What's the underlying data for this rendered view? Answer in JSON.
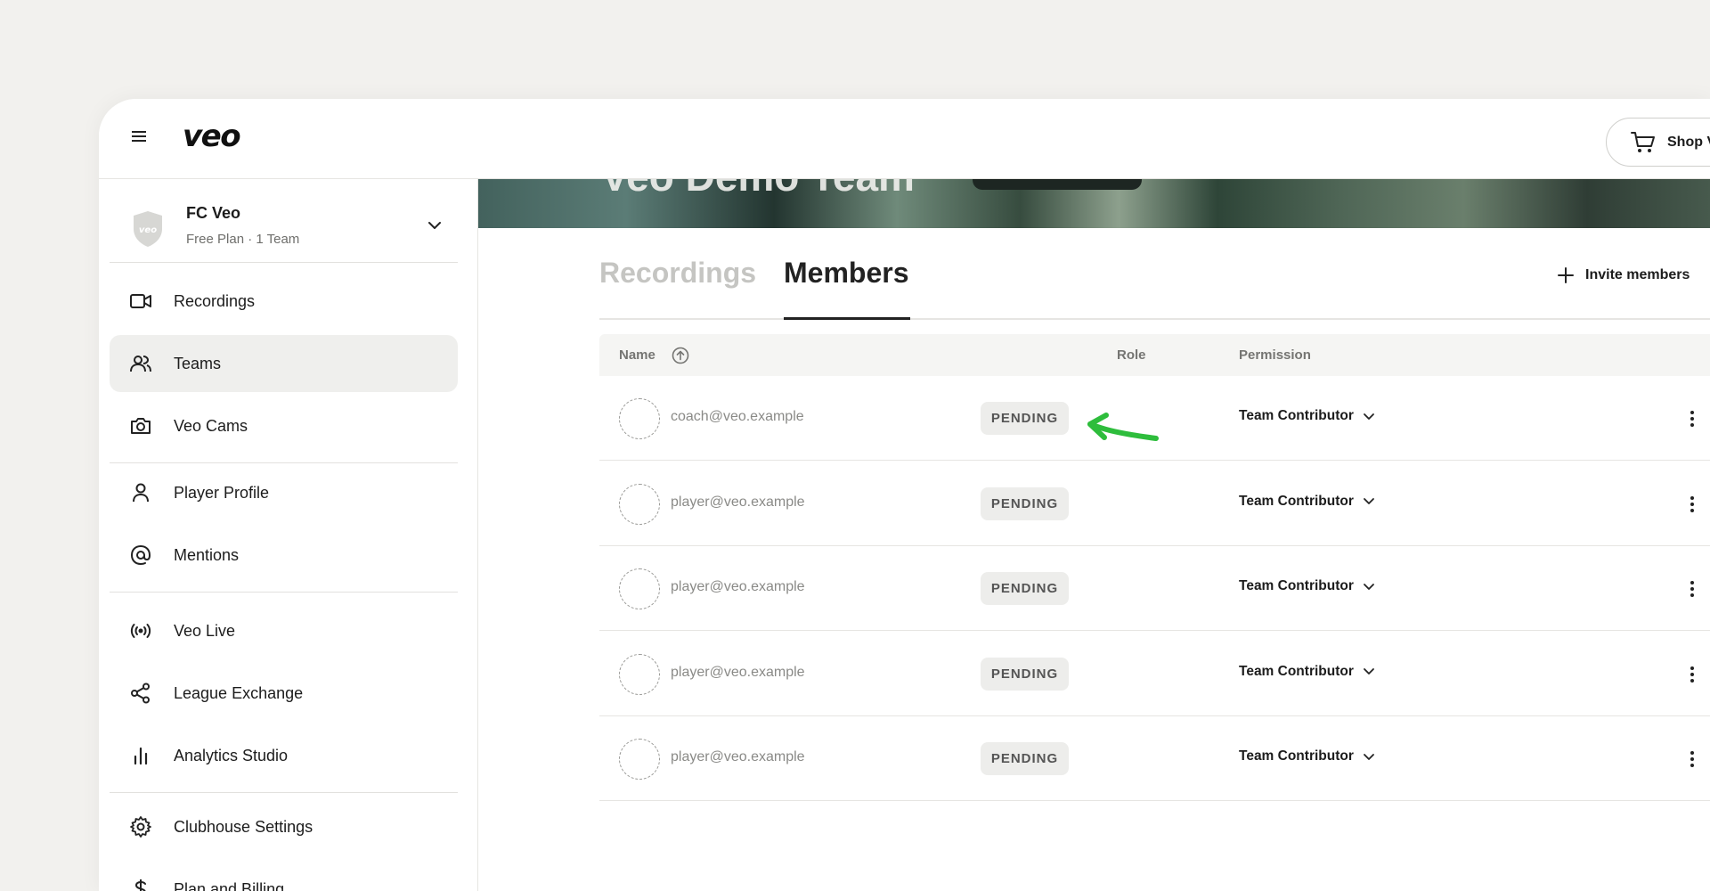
{
  "app": {
    "logo": "veo"
  },
  "header": {
    "shop_label": "Shop V"
  },
  "club": {
    "name": "FC Veo",
    "plan": "Free Plan · 1 Team",
    "shield_text": "veo"
  },
  "sidebar": {
    "items": [
      {
        "label": "Recordings",
        "icon": "video-icon"
      },
      {
        "label": "Teams",
        "icon": "users-icon",
        "active": true
      },
      {
        "label": "Veo Cams",
        "icon": "camera-icon"
      },
      {
        "label": "Player Profile",
        "icon": "person-icon"
      },
      {
        "label": "Mentions",
        "icon": "at-icon"
      },
      {
        "label": "Veo Live",
        "icon": "broadcast-icon"
      },
      {
        "label": "League Exchange",
        "icon": "share-icon"
      },
      {
        "label": "Analytics Studio",
        "icon": "bar-chart-icon"
      },
      {
        "label": "Clubhouse Settings",
        "icon": "gear-icon"
      },
      {
        "label": "Plan and Billing",
        "icon": "dollar-icon"
      }
    ]
  },
  "hero": {
    "title": "Veo Demo Team"
  },
  "tabs": [
    {
      "label": "Recordings",
      "active": false
    },
    {
      "label": "Members",
      "active": true
    }
  ],
  "invite": {
    "label": "Invite members"
  },
  "table": {
    "headers": {
      "name": "Name",
      "role": "Role",
      "permission": "Permission"
    },
    "rows": [
      {
        "email": "coach@veo.example",
        "status": "PENDING",
        "permission": "Team Contributor"
      },
      {
        "email": "player@veo.example",
        "status": "PENDING",
        "permission": "Team Contributor"
      },
      {
        "email": "player@veo.example",
        "status": "PENDING",
        "permission": "Team Contributor"
      },
      {
        "email": "player@veo.example",
        "status": "PENDING",
        "permission": "Team Contributor"
      },
      {
        "email": "player@veo.example",
        "status": "PENDING",
        "permission": "Team Contributor"
      }
    ]
  },
  "colors": {
    "annotation_arrow": "#2ebd3c",
    "active_nav_bg": "#efefed",
    "badge_bg": "#ededeb"
  }
}
